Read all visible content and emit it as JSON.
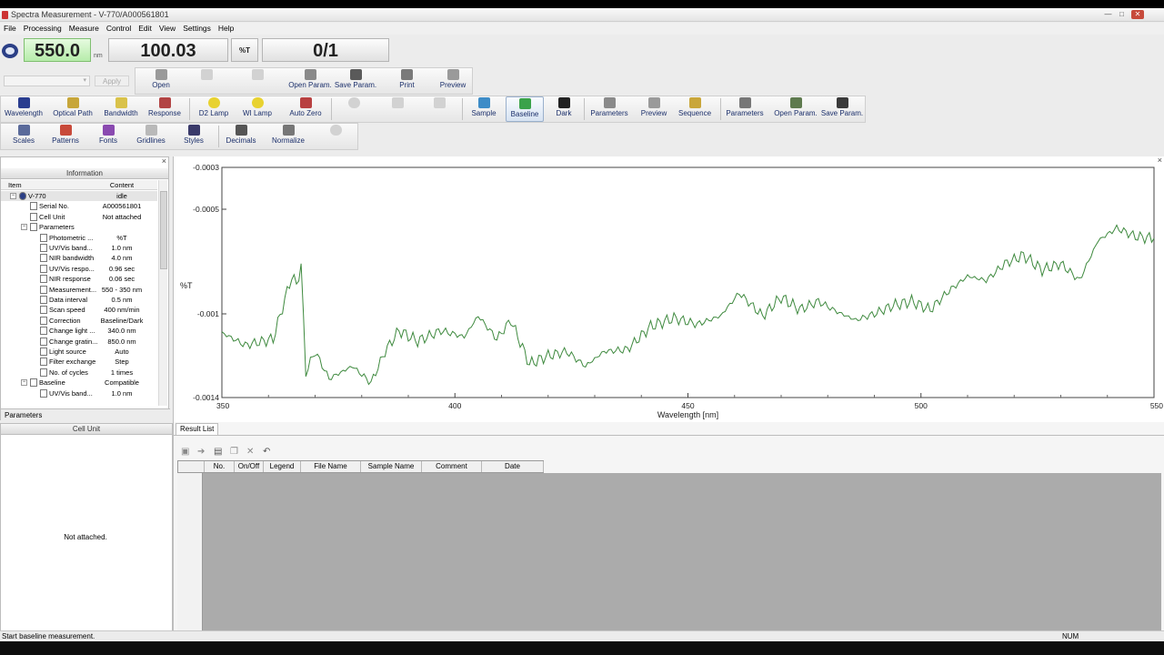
{
  "window": {
    "title": "Spectra Measurement - V-770/A000561801",
    "controls": [
      "—",
      "□",
      "✕"
    ]
  },
  "menu": [
    "File",
    "Processing",
    "Measure",
    "Control",
    "Edit",
    "View",
    "Settings",
    "Help"
  ],
  "display": {
    "wavelength": "550.0",
    "wavelength_unit": "nm",
    "value": "100.03",
    "value_unit": "%T",
    "count": "0/1"
  },
  "toolbar1": {
    "apply_label": "Apply",
    "buttons": [
      {
        "label": "Open",
        "icon": "open-icon",
        "enabled": true
      },
      {
        "label": "",
        "icon": "save-icon",
        "enabled": false
      },
      {
        "label": "",
        "icon": "save-as-icon",
        "enabled": false
      },
      {
        "label": "Open Param.",
        "icon": "open-param-icon",
        "enabled": true
      },
      {
        "label": "Save Param.",
        "icon": "save-param-icon",
        "enabled": true
      },
      {
        "label": "Print",
        "icon": "print-icon",
        "enabled": true
      },
      {
        "label": "Preview",
        "icon": "preview-icon",
        "enabled": true
      }
    ]
  },
  "toolbar2": {
    "buttons": [
      {
        "label": "Wavelength",
        "icon": "wavelength-icon",
        "enabled": true
      },
      {
        "label": "Optical Path",
        "icon": "optical-path-icon",
        "enabled": true
      },
      {
        "label": "Bandwidth",
        "icon": "bandwidth-icon",
        "enabled": true
      },
      {
        "label": "Response",
        "icon": "response-icon",
        "enabled": true
      },
      {
        "label": "D2 Lamp",
        "icon": "d2-lamp-icon",
        "enabled": true
      },
      {
        "label": "WI Lamp",
        "icon": "wi-lamp-icon",
        "enabled": true
      },
      {
        "label": "Auto Zero",
        "icon": "auto-zero-icon",
        "enabled": true
      },
      {
        "label": "",
        "icon": "cell-icon",
        "enabled": false
      },
      {
        "label": "",
        "icon": "start-icon",
        "enabled": false
      },
      {
        "label": "",
        "icon": "stop-icon",
        "enabled": false
      },
      {
        "label": "Sample",
        "icon": "sample-icon",
        "enabled": true
      },
      {
        "label": "Baseline",
        "icon": "baseline-icon",
        "enabled": true,
        "active": true
      },
      {
        "label": "Dark",
        "icon": "dark-icon",
        "enabled": true
      },
      {
        "label": "Parameters",
        "icon": "parameters-icon",
        "enabled": true
      },
      {
        "label": "Preview",
        "icon": "preview-icon",
        "enabled": true
      },
      {
        "label": "Sequence",
        "icon": "sequence-icon",
        "enabled": true
      },
      {
        "label": "Parameters",
        "icon": "parameters-icon",
        "enabled": true
      },
      {
        "label": "Open Param.",
        "icon": "open-param-icon",
        "enabled": true
      },
      {
        "label": "Save Param.",
        "icon": "save-param-icon",
        "enabled": true
      }
    ]
  },
  "toolbar3": {
    "buttons": [
      {
        "label": "Scales",
        "icon": "scales-icon",
        "enabled": true
      },
      {
        "label": "Patterns",
        "icon": "patterns-icon",
        "enabled": true
      },
      {
        "label": "Fonts",
        "icon": "fonts-icon",
        "enabled": true
      },
      {
        "label": "Gridlines",
        "icon": "gridlines-icon",
        "enabled": true
      },
      {
        "label": "Styles",
        "icon": "styles-icon",
        "enabled": true
      },
      {
        "label": "Decimals",
        "icon": "decimals-icon",
        "enabled": true
      },
      {
        "label": "Normalize",
        "icon": "normalize-icon",
        "enabled": true
      },
      {
        "label": "",
        "icon": "info-icon",
        "enabled": false
      }
    ]
  },
  "info_panel": {
    "title": "Information",
    "col_item": "Item",
    "col_content": "Content",
    "tab": "Parameters",
    "rows": [
      {
        "level": 0,
        "expander": "⊟",
        "label": "V-770",
        "value": "idle",
        "selected": true
      },
      {
        "level": 1,
        "expander": "",
        "label": "Serial No.",
        "value": "A000561801"
      },
      {
        "level": 1,
        "expander": "",
        "label": "Cell Unit",
        "value": "Not attached"
      },
      {
        "level": 1,
        "expander": "⊟",
        "label": "Parameters",
        "value": ""
      },
      {
        "level": 2,
        "expander": "",
        "label": "Photometric ...",
        "value": "%T"
      },
      {
        "level": 2,
        "expander": "",
        "label": "UV/Vis band...",
        "value": "1.0 nm"
      },
      {
        "level": 2,
        "expander": "",
        "label": "NIR bandwidth",
        "value": "4.0 nm"
      },
      {
        "level": 2,
        "expander": "",
        "label": "UV/Vis respo...",
        "value": "0.96 sec"
      },
      {
        "level": 2,
        "expander": "",
        "label": "NIR response",
        "value": "0.06 sec"
      },
      {
        "level": 2,
        "expander": "",
        "label": "Measurement...",
        "value": "550 - 350 nm"
      },
      {
        "level": 2,
        "expander": "",
        "label": "Data interval",
        "value": "0.5 nm"
      },
      {
        "level": 2,
        "expander": "",
        "label": "Scan speed",
        "value": "400 nm/min"
      },
      {
        "level": 2,
        "expander": "",
        "label": "Correction",
        "value": "Baseline/Dark"
      },
      {
        "level": 2,
        "expander": "",
        "label": "Change light ...",
        "value": "340.0 nm"
      },
      {
        "level": 2,
        "expander": "",
        "label": "Change gratin...",
        "value": "850.0 nm"
      },
      {
        "level": 2,
        "expander": "",
        "label": "Light source",
        "value": "Auto"
      },
      {
        "level": 2,
        "expander": "",
        "label": "Filter exchange",
        "value": "Step"
      },
      {
        "level": 2,
        "expander": "",
        "label": "No. of cycles",
        "value": "1 times"
      },
      {
        "level": 1,
        "expander": "⊟",
        "label": "Baseline",
        "value": "Compatible"
      },
      {
        "level": 2,
        "expander": "",
        "label": "UV/Vis band...",
        "value": "1.0 nm"
      }
    ]
  },
  "cell_unit": {
    "title": "Cell Unit",
    "message": "Not attached."
  },
  "results": {
    "tab": "Result List",
    "columns": [
      "No.",
      "On/Off",
      "Legend",
      "File Name",
      "Sample Name",
      "Comment",
      "Date"
    ]
  },
  "status": {
    "message": "Start baseline measurement.",
    "num": "NUM"
  },
  "colors": {
    "trace": "#3f8a3f",
    "display_green": "#b6ecaa"
  },
  "chart_data": {
    "type": "line",
    "xlabel": "Wavelength [nm]",
    "ylabel": "%T",
    "xlim": [
      350,
      550
    ],
    "ylim": [
      -0.0014,
      -0.0003
    ],
    "x_ticks": [
      350,
      400,
      450,
      500,
      550
    ],
    "y_ticks": [
      -0.0014,
      -0.001,
      -0.0005,
      -0.0003
    ],
    "y_tick_labels": [
      "-0.0014",
      "-0.001",
      "-0.0005",
      "-0.0003"
    ],
    "grid": false,
    "series": [
      {
        "x": [
          350,
          355,
          361,
          365,
          366,
          367,
          368,
          370,
          373,
          378,
          382,
          385,
          388,
          392,
          397,
          402,
          405,
          409,
          412,
          416,
          420,
          424,
          428,
          432,
          437,
          442,
          447,
          452,
          457,
          461,
          466,
          470,
          474,
          478,
          482,
          486,
          490,
          494,
          498,
          502,
          506,
          510,
          514,
          518,
          522,
          526,
          530,
          534,
          538,
          542,
          546,
          550
        ],
        "y": [
          -0.00109,
          -0.00115,
          -0.00112,
          -0.00082,
          -0.00086,
          -0.00077,
          -0.00128,
          -0.00118,
          -0.00131,
          -0.00125,
          -0.00133,
          -0.00118,
          -0.00108,
          -0.00113,
          -0.00108,
          -0.00111,
          -0.00101,
          -0.00112,
          -0.00103,
          -0.00124,
          -0.0012,
          -0.00118,
          -0.00125,
          -0.00118,
          -0.00117,
          -0.00106,
          -0.00102,
          -0.00105,
          -0.00101,
          -0.0009,
          -0.00101,
          -0.00092,
          -0.00098,
          -0.00094,
          -0.00099,
          -0.00103,
          -0.001,
          -0.00096,
          -0.00094,
          -0.00098,
          -0.00089,
          -0.00082,
          -0.00084,
          -0.00076,
          -0.00072,
          -0.00079,
          -0.00076,
          -0.00084,
          -0.00065,
          -0.00059,
          -0.00063,
          -0.00064
        ]
      }
    ]
  }
}
